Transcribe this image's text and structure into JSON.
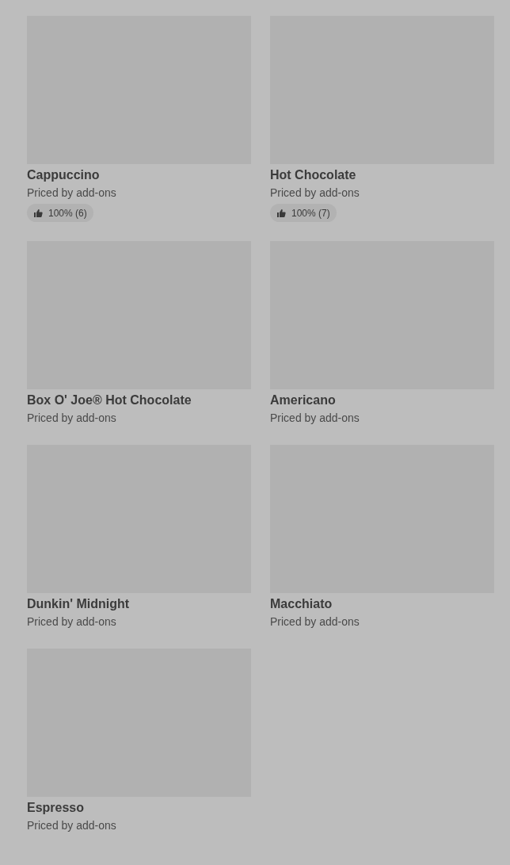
{
  "items": [
    {
      "name": "Cappuccino",
      "price": "Priced by add-ons",
      "rating": "100% (6)"
    },
    {
      "name": "Hot Chocolate",
      "price": "Priced by add-ons",
      "rating": "100% (7)"
    },
    {
      "name": "Box O' Joe® Hot Chocolate",
      "price": "Priced by add-ons"
    },
    {
      "name": "Americano",
      "price": "Priced by add-ons"
    },
    {
      "name": "Dunkin' Midnight",
      "price": "Priced by add-ons"
    },
    {
      "name": "Macchiato",
      "price": "Priced by add-ons"
    },
    {
      "name": "Espresso",
      "price": "Priced by add-ons"
    }
  ]
}
